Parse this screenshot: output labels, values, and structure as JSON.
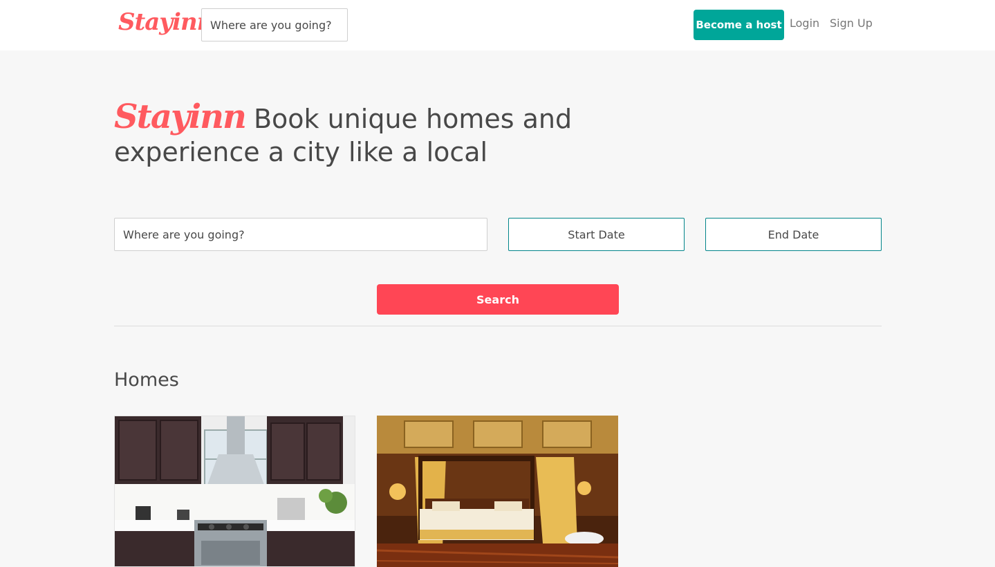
{
  "header": {
    "logo": "Stayinn",
    "search_placeholder": "Where are you going?",
    "become_host_label": "Become a host",
    "login_label": "Login",
    "signup_label": "Sign Up"
  },
  "hero": {
    "brand": "Stayinn",
    "tagline": "Book unique homes and experience a city like a local"
  },
  "search": {
    "destination_placeholder": "Where are you going?",
    "start_date_label": "Start Date",
    "end_date_label": "End Date",
    "search_label": "Search"
  },
  "homes": {
    "title": "Homes"
  },
  "colors": {
    "brand": "#ff5a5f",
    "host_button": "#00a699",
    "search_button": "#ff4655",
    "date_border": "#008489"
  }
}
